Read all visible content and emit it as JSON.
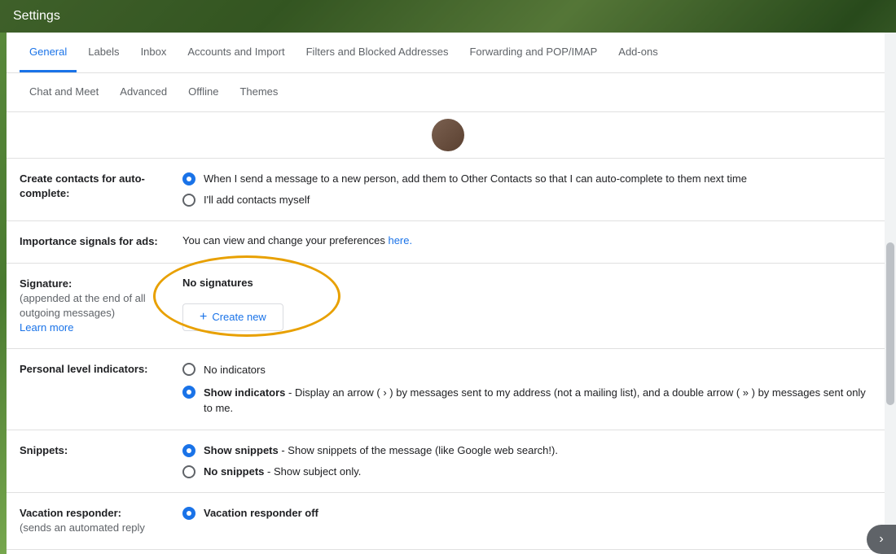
{
  "titleBar": {
    "title": "Settings"
  },
  "tabs": {
    "row1": [
      {
        "id": "general",
        "label": "General",
        "active": true
      },
      {
        "id": "labels",
        "label": "Labels",
        "active": false
      },
      {
        "id": "inbox",
        "label": "Inbox",
        "active": false
      },
      {
        "id": "accounts-import",
        "label": "Accounts and Import",
        "active": false
      },
      {
        "id": "filters-blocked",
        "label": "Filters and Blocked Addresses",
        "active": false
      },
      {
        "id": "forwarding-pop-imap",
        "label": "Forwarding and POP/IMAP",
        "active": false
      },
      {
        "id": "add-ons",
        "label": "Add-ons",
        "active": false
      }
    ],
    "row2": [
      {
        "id": "chat-meet",
        "label": "Chat and Meet",
        "active": false
      },
      {
        "id": "advanced",
        "label": "Advanced",
        "active": false
      },
      {
        "id": "offline",
        "label": "Offline",
        "active": false
      },
      {
        "id": "themes",
        "label": "Themes",
        "active": false
      }
    ]
  },
  "settings": {
    "createContacts": {
      "label": "Create contacts for auto-complete:",
      "options": [
        {
          "id": "auto-add",
          "checked": true,
          "text": "When I send a message to a new person, add them to Other Contacts so that I can auto-complete to them next time"
        },
        {
          "id": "manual-add",
          "checked": false,
          "text": "I'll add contacts myself"
        }
      ]
    },
    "importanceSignals": {
      "label": "Importance signals for ads:",
      "text": "You can view and change your preferences ",
      "linkText": "here.",
      "linkHref": "#"
    },
    "signature": {
      "label": "Signature:",
      "sublabel": "(appended at the end of all outgoing messages)",
      "learnMoreText": "Learn more",
      "noSignaturesText": "No signatures",
      "createNewText": "+ Create new"
    },
    "personalLevel": {
      "label": "Personal level indicators:",
      "options": [
        {
          "id": "no-indicators",
          "checked": false,
          "text": "No indicators"
        },
        {
          "id": "show-indicators",
          "checked": true,
          "text": "Show indicators",
          "description": " - Display an arrow ( › ) by messages sent to my address (not a mailing list), and a double arrow ( » ) by messages sent only to me."
        }
      ]
    },
    "snippets": {
      "label": "Snippets:",
      "options": [
        {
          "id": "show-snippets",
          "checked": true,
          "text": "Show snippets",
          "description": " - Show snippets of the message (like Google web search!)."
        },
        {
          "id": "no-snippets",
          "checked": false,
          "text": "No snippets",
          "description": " - Show subject only."
        }
      ]
    },
    "vacationResponder": {
      "label": "Vacation responder:",
      "sublabel": "(sends an automated reply",
      "options": [
        {
          "id": "vacation-off",
          "checked": true,
          "text": "Vacation responder off"
        }
      ]
    }
  }
}
